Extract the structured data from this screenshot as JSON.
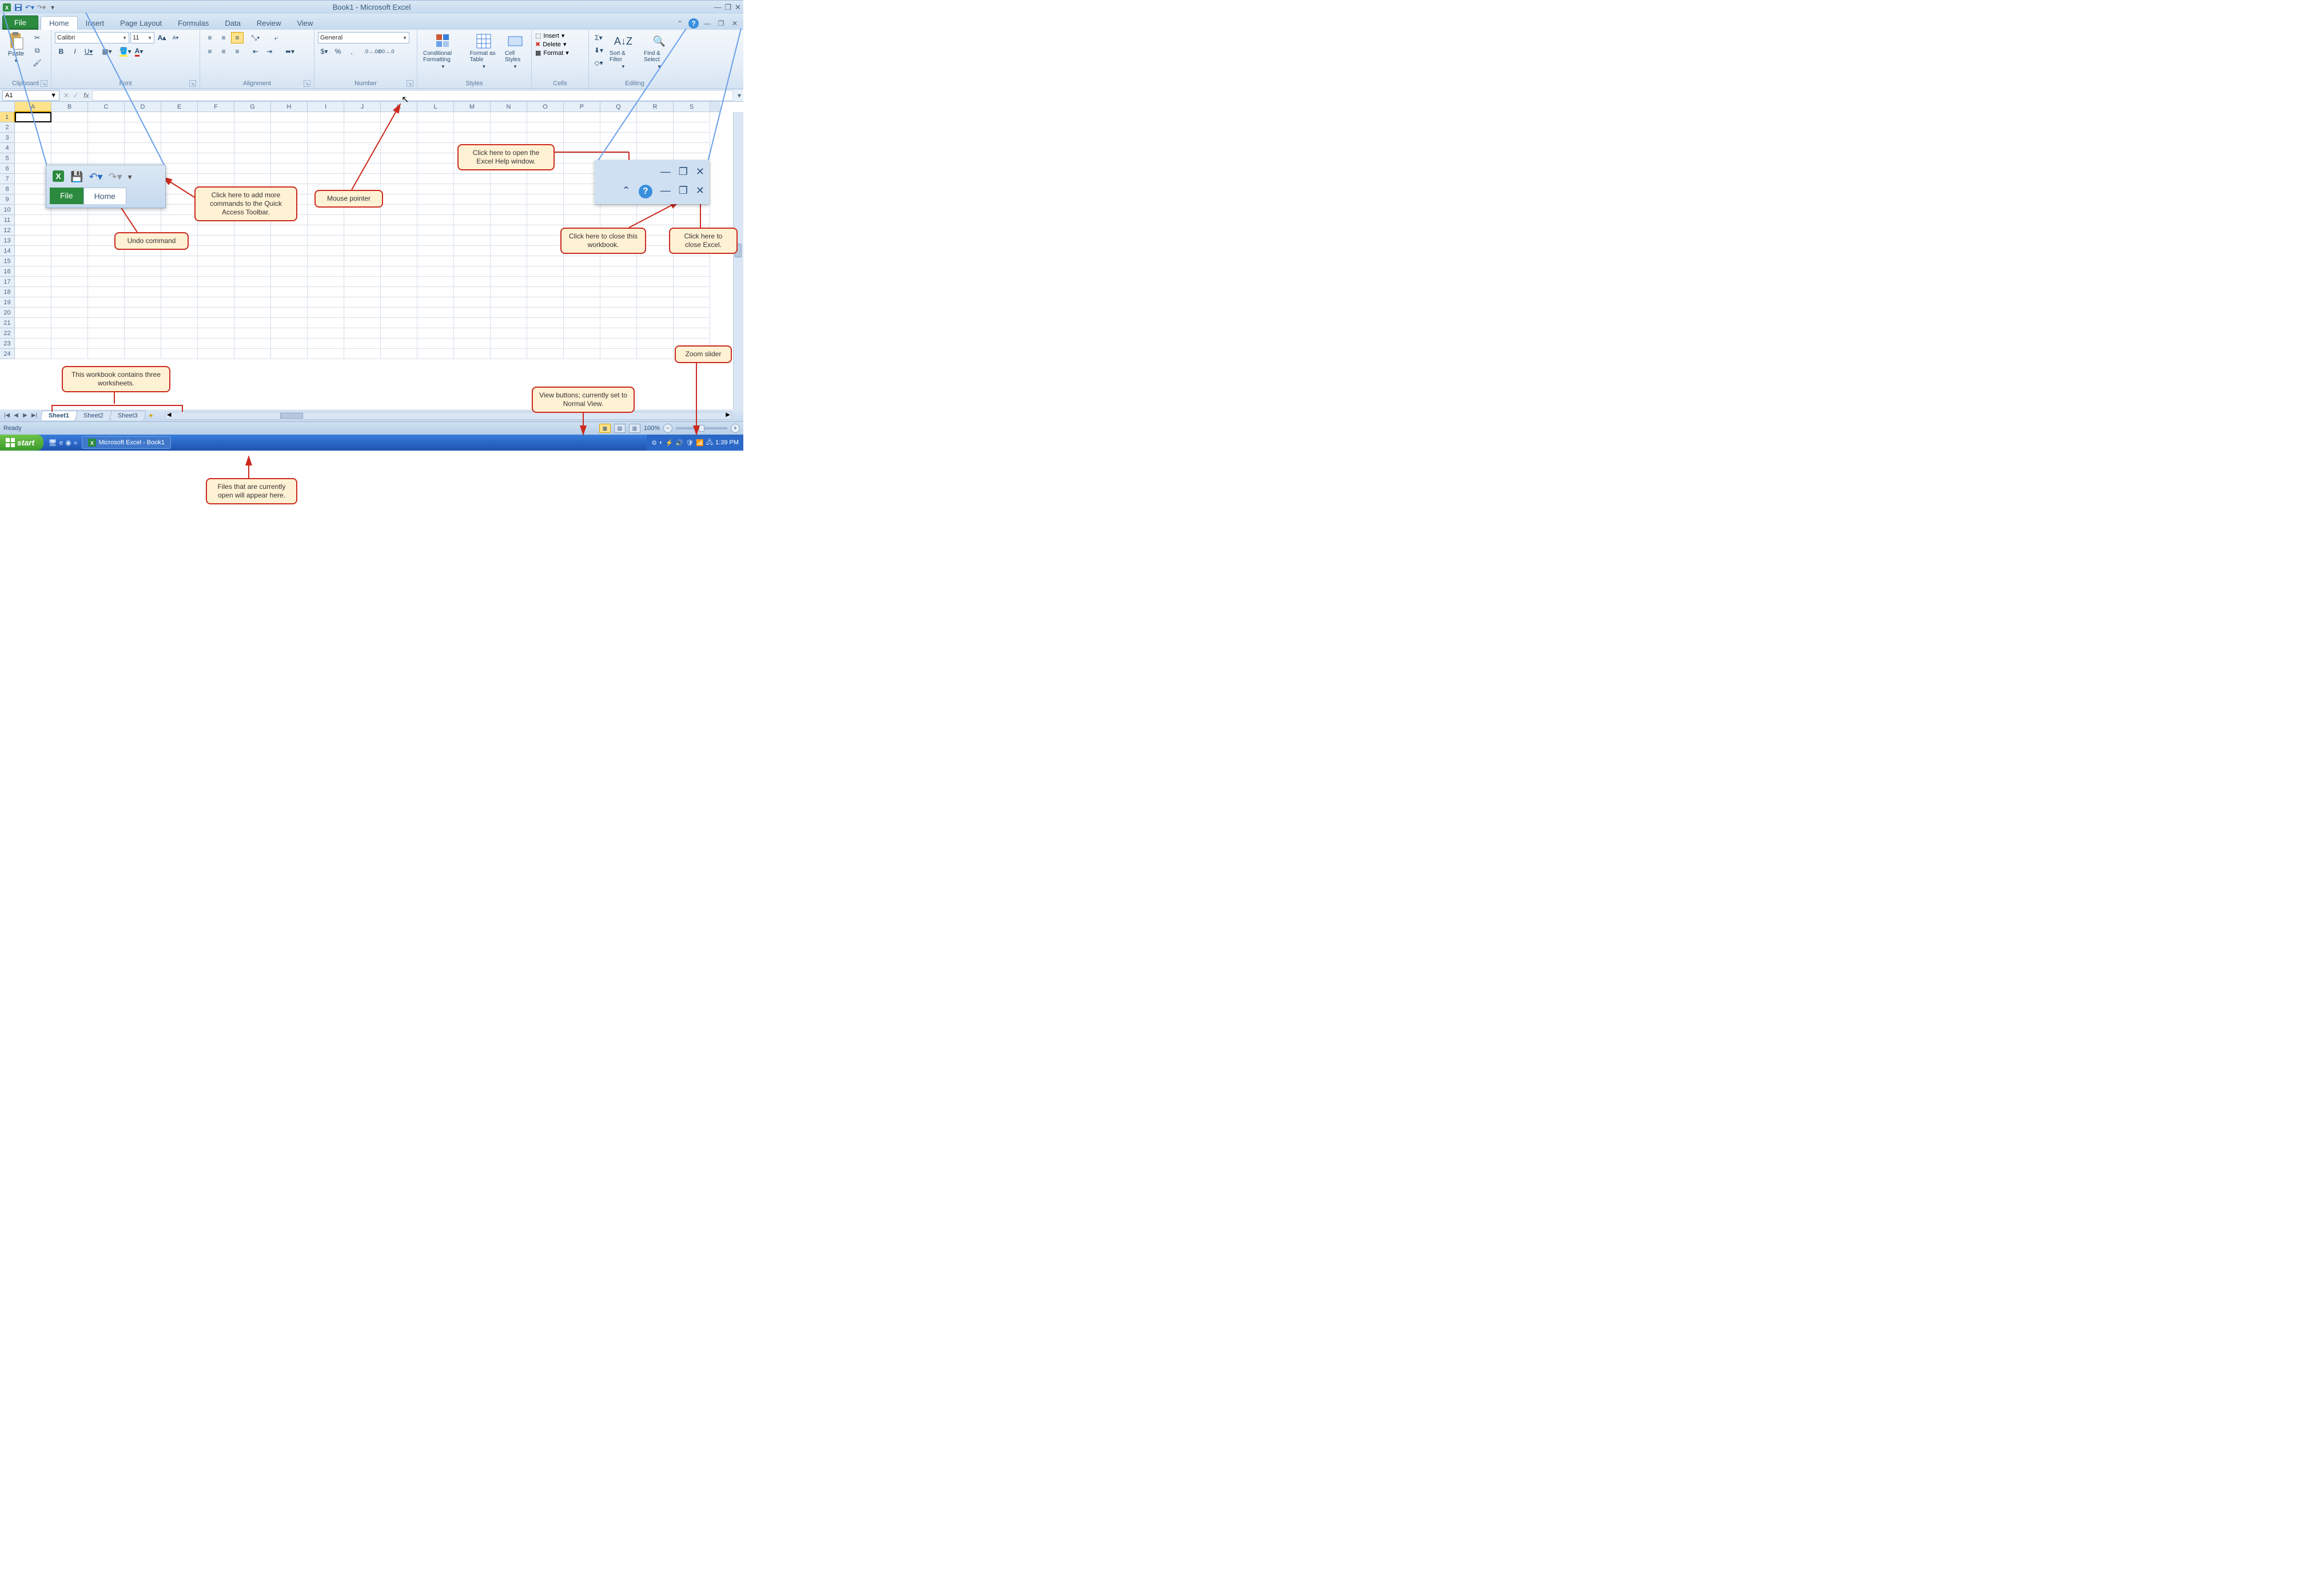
{
  "title": "Book1 - Microsoft Excel",
  "qat": {
    "save": "Save",
    "undo": "Undo",
    "redo": "Redo",
    "customize": "Customize"
  },
  "tabs": {
    "file": "File",
    "home": "Home",
    "insert": "Insert",
    "page_layout": "Page Layout",
    "formulas": "Formulas",
    "data": "Data",
    "review": "Review",
    "view": "View"
  },
  "ribbon": {
    "clipboard": {
      "label": "Clipboard",
      "paste": "Paste"
    },
    "font": {
      "label": "Font",
      "name": "Calibri",
      "size": "11"
    },
    "alignment": {
      "label": "Alignment"
    },
    "number": {
      "label": "Number",
      "format": "General"
    },
    "styles": {
      "label": "Styles",
      "cond": "Conditional Formatting",
      "table": "Format as Table",
      "cell": "Cell Styles"
    },
    "cells": {
      "label": "Cells",
      "insert": "Insert",
      "delete": "Delete",
      "format": "Format"
    },
    "editing": {
      "label": "Editing",
      "sort": "Sort & Filter",
      "find": "Find & Select"
    }
  },
  "name_box": "A1",
  "columns": [
    "A",
    "B",
    "C",
    "D",
    "E",
    "F",
    "G",
    "H",
    "I",
    "J",
    "K",
    "L",
    "M",
    "N",
    "O",
    "P",
    "Q",
    "R",
    "S"
  ],
  "rows": [
    "1",
    "2",
    "3",
    "4",
    "5",
    "6",
    "7",
    "8",
    "9",
    "10",
    "11",
    "12",
    "13",
    "14",
    "15",
    "16",
    "17",
    "18",
    "19",
    "20",
    "21",
    "22",
    "23",
    "24"
  ],
  "sheets": {
    "s1": "Sheet1",
    "s2": "Sheet2",
    "s3": "Sheet3"
  },
  "status": {
    "ready": "Ready",
    "zoom": "100%"
  },
  "taskbar": {
    "start": "start",
    "item": "Microsoft Excel - Book1",
    "time": "1:39 PM"
  },
  "callouts": {
    "help": "Click here to open the Excel Help window.",
    "qat": "Click here to add more commands to the Quick Access Toolbar.",
    "undo": "Undo command",
    "mouse": "Mouse pointer",
    "close_wb": "Click here to close this workbook.",
    "close_excel": "Click here to close Excel.",
    "sheets": "This workbook contains three worksheets.",
    "views": "View buttons; currently set to Normal View.",
    "zoom": "Zoom slider",
    "files": "Files that are currently open will appear here."
  }
}
